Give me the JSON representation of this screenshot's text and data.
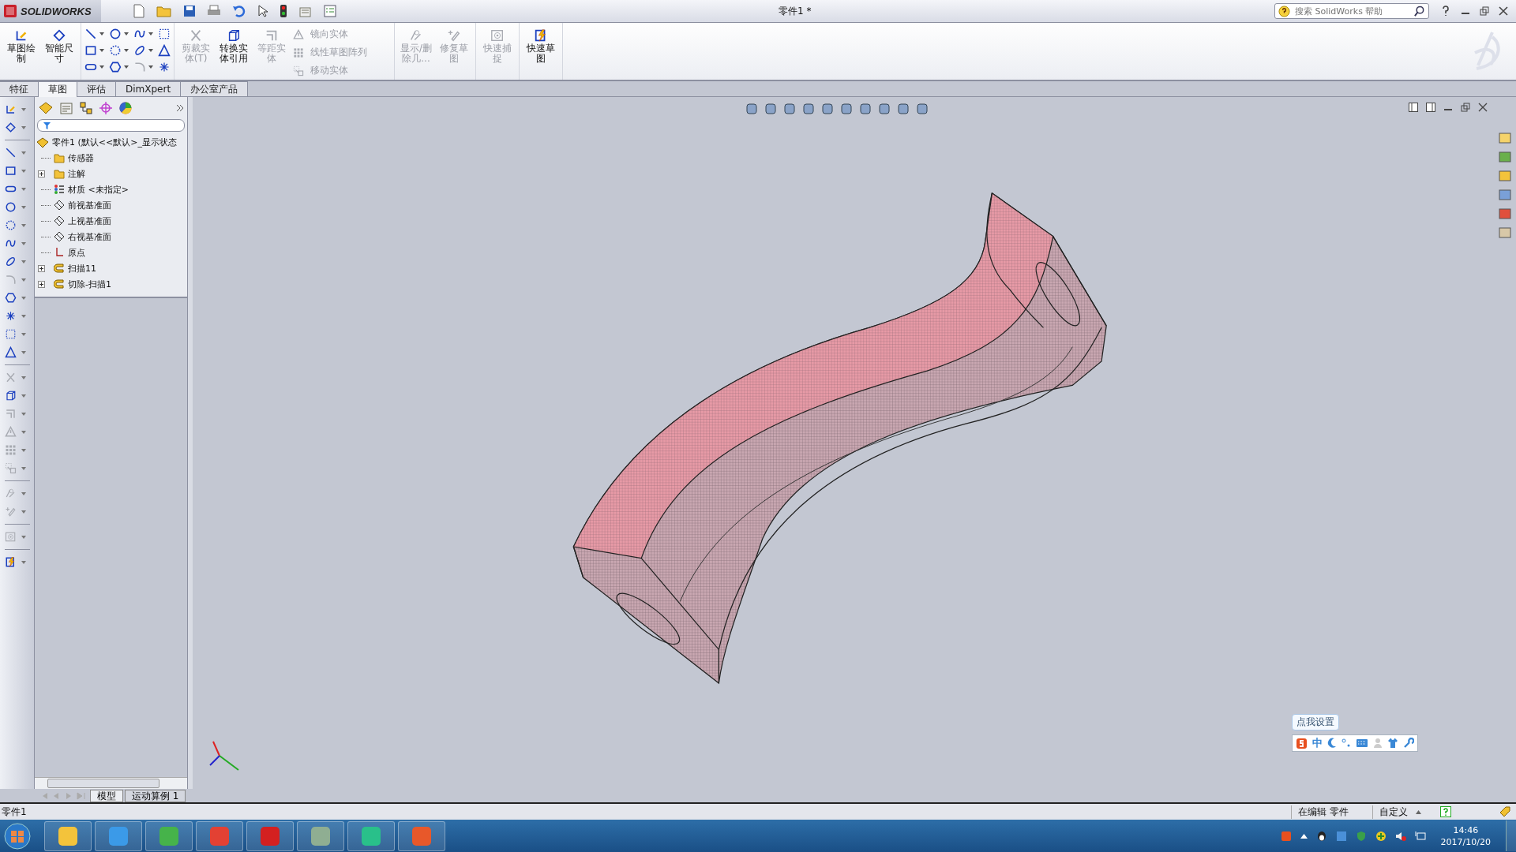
{
  "title_bar": {
    "logo": "SOLIDWORKS",
    "title": "零件1 *",
    "search": {
      "placeholder": "搜索 SolidWorks 帮助"
    }
  },
  "ribbon": {
    "sketch_tools": [
      {
        "disabled": false
      },
      {
        "disabled": false
      },
      {
        "disabled": false
      },
      {
        "disabled": false
      },
      {
        "disabled": false
      },
      {
        "disabled": false
      },
      {
        "disabled": false
      },
      {
        "disabled": false
      },
      {
        "disabled": false
      },
      {
        "disabled": false
      },
      {
        "disabled": true
      },
      {
        "disabled": false
      }
    ],
    "groups": [
      {
        "items": [
          {
            "kind": "large",
            "label": "草图绘制",
            "disabled": false
          },
          {
            "kind": "large",
            "label": "智能尺寸",
            "disabled": false
          }
        ]
      },
      {
        "items": [
          {
            "kind": "tools"
          }
        ]
      },
      {
        "items": [
          {
            "kind": "large",
            "label": "剪裁实体(T)",
            "disabled": true
          },
          {
            "kind": "large",
            "label": "转换实体引用",
            "disabled": false
          },
          {
            "kind": "large",
            "label": "等距实体",
            "disabled": true
          },
          {
            "kind": "small",
            "label": "镜向实体",
            "disabled": true
          },
          {
            "kind": "small",
            "label": "线性草图阵列",
            "disabled": true
          },
          {
            "kind": "small",
            "label": "移动实体",
            "disabled": true
          }
        ]
      },
      {
        "items": [
          {
            "kind": "large",
            "label": "显示/删除几...",
            "disabled": true
          },
          {
            "kind": "large",
            "label": "修复草图",
            "disabled": true
          }
        ]
      },
      {
        "items": [
          {
            "kind": "large",
            "label": "快速捕捉",
            "disabled": true
          }
        ]
      },
      {
        "items": [
          {
            "kind": "large",
            "label": "快速草图",
            "disabled": false
          }
        ]
      }
    ]
  },
  "tabs": [
    {
      "label": "特征",
      "selected": false
    },
    {
      "label": "草图",
      "selected": true
    },
    {
      "label": "评估",
      "selected": false
    },
    {
      "label": "DimXpert",
      "selected": false
    },
    {
      "label": "办公室产品",
      "selected": false
    }
  ],
  "left_toolbar": [
    {
      "kind": "tool",
      "disabled": false
    },
    {
      "kind": "tool",
      "disabled": false
    },
    {
      "kind": "separator"
    },
    {
      "kind": "tool",
      "disabled": false
    },
    {
      "kind": "tool",
      "disabled": false
    },
    {
      "kind": "tool",
      "disabled": false
    },
    {
      "kind": "tool",
      "disabled": false
    },
    {
      "kind": "tool",
      "disabled": false
    },
    {
      "kind": "tool",
      "disabled": false
    },
    {
      "kind": "tool",
      "disabled": false
    },
    {
      "kind": "tool",
      "disabled": true
    },
    {
      "kind": "tool",
      "disabled": false
    },
    {
      "kind": "tool",
      "disabled": false
    },
    {
      "kind": "tool",
      "disabled": false
    },
    {
      "kind": "tool",
      "disabled": false
    },
    {
      "kind": "separator"
    },
    {
      "kind": "tool",
      "disabled": true
    },
    {
      "kind": "tool",
      "disabled": false
    },
    {
      "kind": "tool",
      "disabled": true
    },
    {
      "kind": "tool",
      "disabled": true
    },
    {
      "kind": "tool",
      "disabled": true
    },
    {
      "kind": "tool",
      "disabled": true
    },
    {
      "kind": "separator"
    },
    {
      "kind": "tool",
      "disabled": true
    },
    {
      "kind": "tool",
      "disabled": true
    },
    {
      "kind": "separator"
    },
    {
      "kind": "tool",
      "disabled": true
    },
    {
      "kind": "separator"
    },
    {
      "kind": "tool",
      "disabled": false
    }
  ],
  "feature_tree": {
    "root": {
      "label": "零件1  (默认<<默认>_显示状态",
      "children": [
        {
          "label": "传感器",
          "expandable": false
        },
        {
          "label": "注解",
          "expandable": true
        },
        {
          "label": "材质 <未指定>",
          "expandable": false
        },
        {
          "label": "前视基准面",
          "expandable": false
        },
        {
          "label": "上视基准面",
          "expandable": false
        },
        {
          "label": "右视基准面",
          "expandable": false
        },
        {
          "label": "原点",
          "expandable": false
        },
        {
          "label": "扫描11",
          "expandable": true
        },
        {
          "label": "切除-扫描1",
          "expandable": true
        }
      ]
    }
  },
  "ime_bar": {
    "tooltip": "点我设置",
    "mode": "中"
  },
  "bottom_tabs": [
    {
      "label": "模型",
      "selected": true
    },
    {
      "label": "运动算例 1",
      "selected": false
    }
  ],
  "status_bar": {
    "document": "零件1",
    "mode": "在编辑 零件",
    "units": "自定义"
  },
  "taskbar": {
    "time": "14:46",
    "date": "2017/10/20"
  }
}
